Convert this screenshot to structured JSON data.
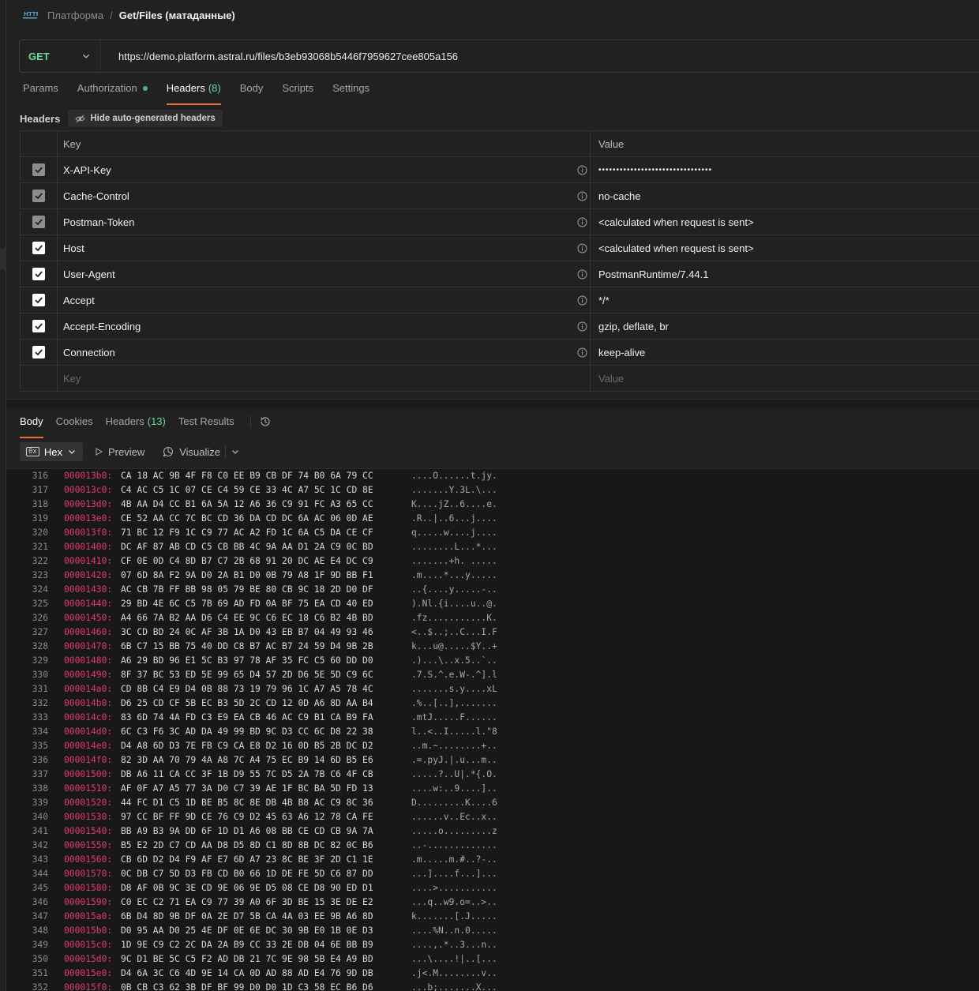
{
  "breadcrumb": {
    "icon": "http-icon",
    "parent": "Платформа",
    "separator": "/",
    "current": "Get/Files (матаданные)"
  },
  "request": {
    "method": "GET",
    "url": "https://demo.platform.astral.ru/files/b3eb93068b5446f7959627cee805a156"
  },
  "request_tabs": [
    {
      "label": "Params",
      "count": ""
    },
    {
      "label": "Authorization",
      "count": ""
    },
    {
      "label": "Headers",
      "count": "(8)"
    },
    {
      "label": "Body",
      "count": ""
    },
    {
      "label": "Scripts",
      "count": ""
    },
    {
      "label": "Settings",
      "count": ""
    }
  ],
  "headers_section": {
    "title": "Headers",
    "hide_label": "Hide auto-generated headers"
  },
  "table": {
    "key_header": "Key",
    "value_header": "Value",
    "rows": [
      {
        "key": "X-API-Key",
        "value": "••••••••••••••••••••••••••••••••",
        "state": "auto"
      },
      {
        "key": "Cache-Control",
        "value": "no-cache",
        "state": "auto"
      },
      {
        "key": "Postman-Token",
        "value": "<calculated when request is sent>",
        "state": "auto"
      },
      {
        "key": "Host",
        "value": "<calculated when request is sent>",
        "state": "on"
      },
      {
        "key": "User-Agent",
        "value": "PostmanRuntime/7.44.1",
        "state": "on"
      },
      {
        "key": "Accept",
        "value": "*/*",
        "state": "on"
      },
      {
        "key": "Accept-Encoding",
        "value": "gzip, deflate, br",
        "state": "on"
      },
      {
        "key": "Connection",
        "value": "keep-alive",
        "state": "on"
      }
    ],
    "key_placeholder": "Key",
    "value_placeholder": "Value"
  },
  "response_tabs": [
    {
      "label": "Body",
      "count": ""
    },
    {
      "label": "Cookies",
      "count": ""
    },
    {
      "label": "Headers",
      "count": "(13)"
    },
    {
      "label": "Test Results",
      "count": ""
    }
  ],
  "response_toolbar": {
    "format_icon": "0x",
    "format": "Hex",
    "preview": "Preview",
    "visualize": "Visualize"
  },
  "colors": {
    "accent": "#ef6c36",
    "method": "#6bdd9a",
    "address": "#e53b6a",
    "auth_dot": "#3fbf6e"
  },
  "hex_lines": [
    {
      "n": "316",
      "addr": "000013b0:",
      "bytes": "CA 18 AC 9B 4F F8 C0 EE B9 CB DF 74 B0 6A 79 CC",
      "ascii": "....O......t.jy."
    },
    {
      "n": "317",
      "addr": "000013c0:",
      "bytes": "C4 AC C5 1C 07 CE C4 59 CE 33 4C A7 5C 1C CD 8E",
      "ascii": ".......Y.3L.\\..."
    },
    {
      "n": "318",
      "addr": "000013d0:",
      "bytes": "4B AA D4 CC B1 6A 5A 12 A6 36 C9 91 FC A3 65 CC",
      "ascii": "K....jZ..6....e."
    },
    {
      "n": "319",
      "addr": "000013e0:",
      "bytes": "CE 52 AA CC 7C BC CD 36 DA CD DC 6A AC 06 0D AE",
      "ascii": ".R..|..6...j...."
    },
    {
      "n": "320",
      "addr": "000013f0:",
      "bytes": "71 BC 12 F9 1C C9 77 AC A2 FD 1C 6A C5 DA CE CF",
      "ascii": "q.....w....j...."
    },
    {
      "n": "321",
      "addr": "00001400:",
      "bytes": "DC AF 87 AB CD C5 CB BB 4C 9A AA D1 2A C9 0C BD",
      "ascii": "........L...*..."
    },
    {
      "n": "322",
      "addr": "00001410:",
      "bytes": "CF 0E 0D C4 8D B7 C7 2B 68 91 20 DC AE E4 DC C9",
      "ascii": ".......+h. ....."
    },
    {
      "n": "323",
      "addr": "00001420:",
      "bytes": "07 6D 8A F2 9A D0 2A B1 D0 0B 79 A8 1F 9D BB F1",
      "ascii": ".m....*...y....."
    },
    {
      "n": "324",
      "addr": "00001430:",
      "bytes": "AC CB 7B FF BB 98 05 79 BE 80 CB 9C 18 2D D0 DF",
      "ascii": "..{....y.....-.."
    },
    {
      "n": "325",
      "addr": "00001440:",
      "bytes": "29 BD 4E 6C C5 7B 69 AD FD 0A BF 75 EA CD 40 ED",
      "ascii": ").Nl.{i....u..@."
    },
    {
      "n": "326",
      "addr": "00001450:",
      "bytes": "A4 66 7A B2 AA D6 C4 EE 9C C6 EC 18 C6 B2 4B BD",
      "ascii": ".fz...........K."
    },
    {
      "n": "327",
      "addr": "00001460:",
      "bytes": "3C CD BD 24 0C AF 3B 1A D0 43 EB B7 04 49 93 46",
      "ascii": "<..$..;..C...I.F"
    },
    {
      "n": "328",
      "addr": "00001470:",
      "bytes": "6B C7 15 BB 75 40 DD C8 B7 AC B7 24 59 D4 9B 2B",
      "ascii": "k...u@.....$Y..+"
    },
    {
      "n": "329",
      "addr": "00001480:",
      "bytes": "A6 29 BD 96 E1 5C B3 97 78 AF 35 FC C5 60 DD D0",
      "ascii": ".)...\\..x.5..`.."
    },
    {
      "n": "330",
      "addr": "00001490:",
      "bytes": "8F 37 BC 53 ED 5E 99 65 D4 57 2D D6 5E 5D C9 6C",
      "ascii": ".7.S.^.e.W-.^].l"
    },
    {
      "n": "331",
      "addr": "000014a0:",
      "bytes": "CD 8B C4 E9 D4 0B 88 73 19 79 96 1C A7 A5 78 4C",
      "ascii": ".......s.y....xL"
    },
    {
      "n": "332",
      "addr": "000014b0:",
      "bytes": "D6 25 CD CF 5B EC B3 5D 2C CD 12 0D A6 8D AA B4",
      "ascii": ".%..[..],......."
    },
    {
      "n": "333",
      "addr": "000014c0:",
      "bytes": "83 6D 74 4A FD C3 E9 EA CB 46 AC C9 B1 CA B9 FA",
      "ascii": ".mtJ.....F......"
    },
    {
      "n": "334",
      "addr": "000014d0:",
      "bytes": "6C C3 F6 3C AD DA 49 99 BD 9C D3 CC 6C D8 22 38",
      "ascii": "l..<..I.....l.\"8"
    },
    {
      "n": "335",
      "addr": "000014e0:",
      "bytes": "D4 A8 6D D3 7E FB C9 CA E8 D2 16 0D B5 2B DC D2",
      "ascii": "..m.~........+.."
    },
    {
      "n": "336",
      "addr": "000014f0:",
      "bytes": "82 3D AA 70 79 4A A8 7C A4 75 EC B9 14 6D B5 E6",
      "ascii": ".=.pyJ.|.u...m.."
    },
    {
      "n": "337",
      "addr": "00001500:",
      "bytes": "DB A6 11 CA CC 3F 1B D9 55 7C D5 2A 7B C6 4F CB",
      "ascii": ".....?..U|.*{.O."
    },
    {
      "n": "338",
      "addr": "00001510:",
      "bytes": "AF 0F A7 A5 77 3A D0 C7 39 AE 1F BC BA 5D FD 13",
      "ascii": "....w:..9....].."
    },
    {
      "n": "339",
      "addr": "00001520:",
      "bytes": "44 FC D1 C5 1D BE B5 8C 8E DB 4B B8 AC C9 8C 36",
      "ascii": "D.........K....6"
    },
    {
      "n": "340",
      "addr": "00001530:",
      "bytes": "97 CC BF FF 9D CE 76 C9 D2 45 63 A6 12 78 CA FE",
      "ascii": "......v..Ec..x.."
    },
    {
      "n": "341",
      "addr": "00001540:",
      "bytes": "BB A9 B3 9A DD 6F 1D D1 A6 08 BB CE CD CB 9A 7A",
      "ascii": ".....o.........z"
    },
    {
      "n": "342",
      "addr": "00001550:",
      "bytes": "B5 E2 2D C7 CD AA D8 D5 8D C1 8D 8B DC 82 0C B6",
      "ascii": "..-............."
    },
    {
      "n": "343",
      "addr": "00001560:",
      "bytes": "CB 6D D2 D4 F9 AF E7 6D A7 23 8C BE 3F 2D C1 1E",
      "ascii": ".m.....m.#..?-.."
    },
    {
      "n": "344",
      "addr": "00001570:",
      "bytes": "0C DB C7 5D D3 FB CD B0 66 1D DE FE 5D C6 87 DD",
      "ascii": "...]....f...]..."
    },
    {
      "n": "345",
      "addr": "00001580:",
      "bytes": "D8 AF 0B 9C 3E CD 9E 06 9E D5 08 CE D8 90 ED D1",
      "ascii": "....>..........."
    },
    {
      "n": "346",
      "addr": "00001590:",
      "bytes": "C0 EC C2 71 EA C9 77 39 A0 6F 3D BE 15 3E DE E2",
      "ascii": "...q..w9.o=..>.."
    },
    {
      "n": "347",
      "addr": "000015a0:",
      "bytes": "6B D4 8D 9B DF 0A 2E D7 5B CA 4A 03 EE 9B A6 8D",
      "ascii": "k.......[.J....."
    },
    {
      "n": "348",
      "addr": "000015b0:",
      "bytes": "D0 95 AA D0 25 4E DF 0E 6E DC 30 9B E0 1B 0E D3",
      "ascii": "....%N..n.0....."
    },
    {
      "n": "349",
      "addr": "000015c0:",
      "bytes": "1D 9E C9 C2 2C DA 2A B9 CC 33 2E DB 04 6E BB B9",
      "ascii": "....,.*..3...n.."
    },
    {
      "n": "350",
      "addr": "000015d0:",
      "bytes": "9C D1 BE 5C C5 F2 AD DB 21 7C 9E 98 5B E4 A9 BD",
      "ascii": "...\\....!|..[..."
    },
    {
      "n": "351",
      "addr": "000015e0:",
      "bytes": "D4 6A 3C C6 4D 9E 14 CA 0D AD 88 AD E4 76 9D DB",
      "ascii": ".j<.M........v.."
    },
    {
      "n": "352",
      "addr": "000015f0:",
      "bytes": "0B CB C3 62 3B DF BF 99 D0 D0 1D C3 58 EC B6 D6",
      "ascii": "...b;.......X..."
    }
  ]
}
